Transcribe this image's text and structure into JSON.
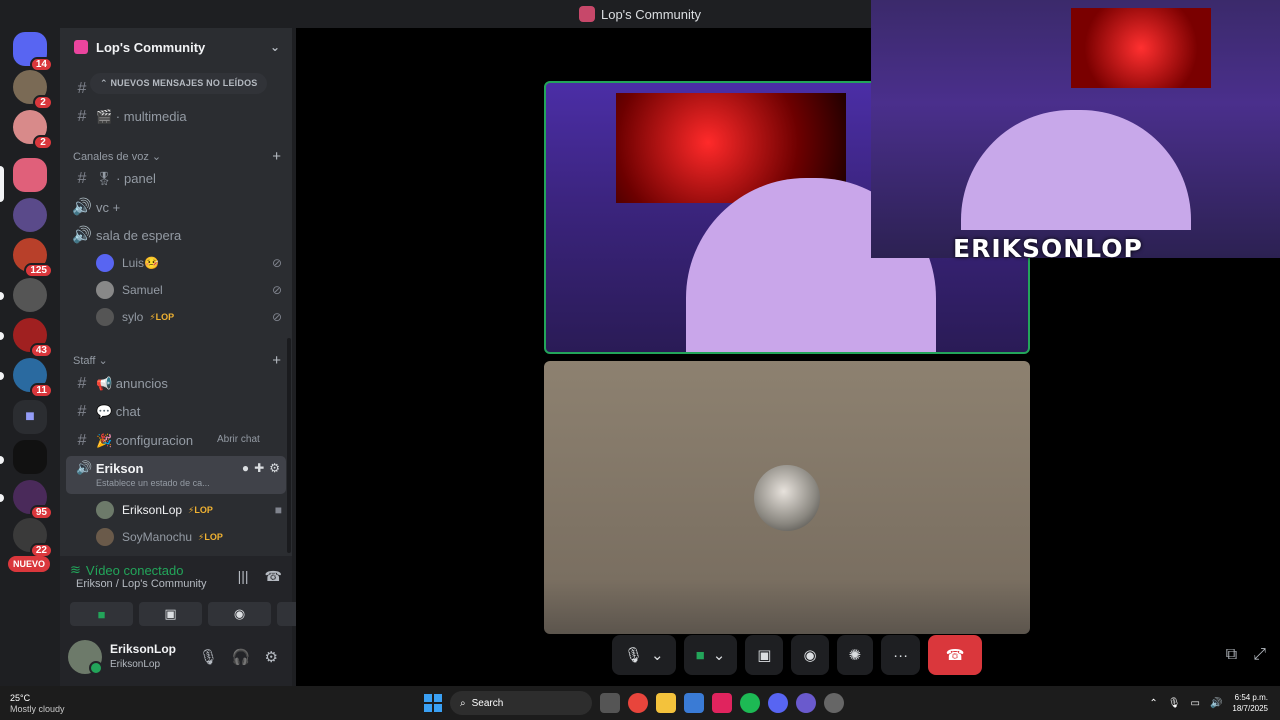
{
  "window": {
    "title": "Lop's Community"
  },
  "rail": {
    "badges": [
      "14",
      "2",
      "2",
      "125",
      "43",
      "11",
      "95",
      "22"
    ],
    "nuevo": "NUEVO"
  },
  "server": {
    "name": "Lop's Community",
    "unread_pill": "NUEVOS MENSAJES NO LEÍDOS"
  },
  "channels": {
    "multimedia": "🎬 · multimedia",
    "voice_category": "Canales de voz",
    "panel": "🎖 · panel",
    "vc": "vc +",
    "sala": "sala de espera",
    "staff_category": "Staff",
    "anuncios": "📢 anuncios",
    "chat": "💬 chat",
    "configuracion": "🎉 configuracion",
    "tooltip": "Abrir chat"
  },
  "voice_users": [
    {
      "name": "Luis🤒",
      "tag": ""
    },
    {
      "name": "Samuel",
      "tag": ""
    },
    {
      "name": "sylo",
      "tag": "⚡LOP"
    }
  ],
  "active_channel": {
    "name": "Erikson",
    "subtitle": "Establece un estado de ca...",
    "members": [
      {
        "name": "EriksonLop",
        "tag": "⚡LOP"
      },
      {
        "name": "SoyManochu",
        "tag": "⚡LOP"
      }
    ]
  },
  "voice_panel": {
    "status": "Vídeo conectado",
    "location": "Erikson / Lop's Community"
  },
  "user": {
    "name": "EriksonLop",
    "status": "EriksonLop"
  },
  "stream": {
    "brand_text": "ERIKSONLOP"
  },
  "taskbar": {
    "temp": "25°C",
    "weather": "Mostly cloudy",
    "search": "Search",
    "time": "6:54 p.m.",
    "date": "18/7/2025"
  },
  "colors": {
    "green": "#23a55a",
    "red": "#da373c",
    "badge": "#da373c"
  }
}
